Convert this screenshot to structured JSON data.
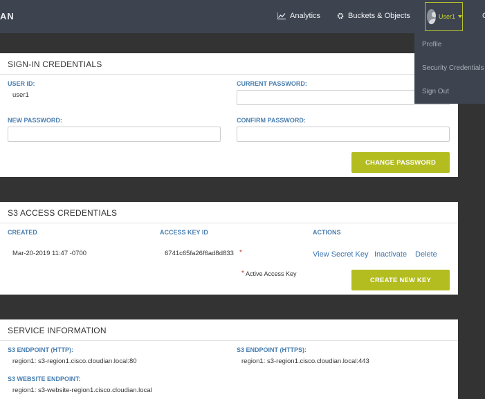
{
  "header": {
    "logo_text": "AN",
    "nav": {
      "analytics": "Analytics",
      "buckets": "Buckets & Objects"
    },
    "user": {
      "name": "User1"
    },
    "far_right_text": "C"
  },
  "user_menu": {
    "items": [
      "Profile",
      "Security Credentials",
      "Sign Out"
    ]
  },
  "signin": {
    "title": "SIGN-IN CREDENTIALS",
    "user_id_label": "USER ID:",
    "user_id_value": "user1",
    "current_password_label": "CURRENT PASSWORD:",
    "new_password_label": "NEW PASSWORD:",
    "confirm_password_label": "CONFIRM PASSWORD:",
    "change_button": "CHANGE PASSWORD"
  },
  "s3": {
    "title": "S3 ACCESS CREDENTIALS",
    "columns": {
      "created": "CREATED",
      "key_id": "ACCESS KEY ID",
      "actions": "ACTIONS"
    },
    "row": {
      "created": "Mar-20-2019 11:47 -0700",
      "key_id": "6741c65fa26f6ad8d833",
      "marker": "*"
    },
    "actions": {
      "view": "View Secret Key",
      "inactivate": "Inactivate",
      "delete": "Delete"
    },
    "note_marker": "*",
    "note": "Active Access Key",
    "create_button": "CREATE NEW KEY"
  },
  "service": {
    "title": "SERVICE INFORMATION",
    "http_label": "S3 ENDPOINT (HTTP):",
    "http_value": "region1:  s3-region1.cisco.cloudian.local:80",
    "https_label": "S3 ENDPOINT (HTTPS):",
    "https_value": "region1:  s3-region1.cisco.cloudian.local:443",
    "website_label": "S3 WEBSITE ENDPOINT:",
    "website_value": "region1:  s3-website-region1.cisco.cloudian.local"
  },
  "colors": {
    "accent": "#b3bd1f",
    "label_blue": "#4a7fb0",
    "link_blue": "#3c76b3",
    "header_bg": "#3d4450",
    "page_bg": "#333333"
  },
  "icons": [
    "analytics-icon",
    "gear-icon",
    "avatar-icon",
    "chevron-down-icon"
  ]
}
